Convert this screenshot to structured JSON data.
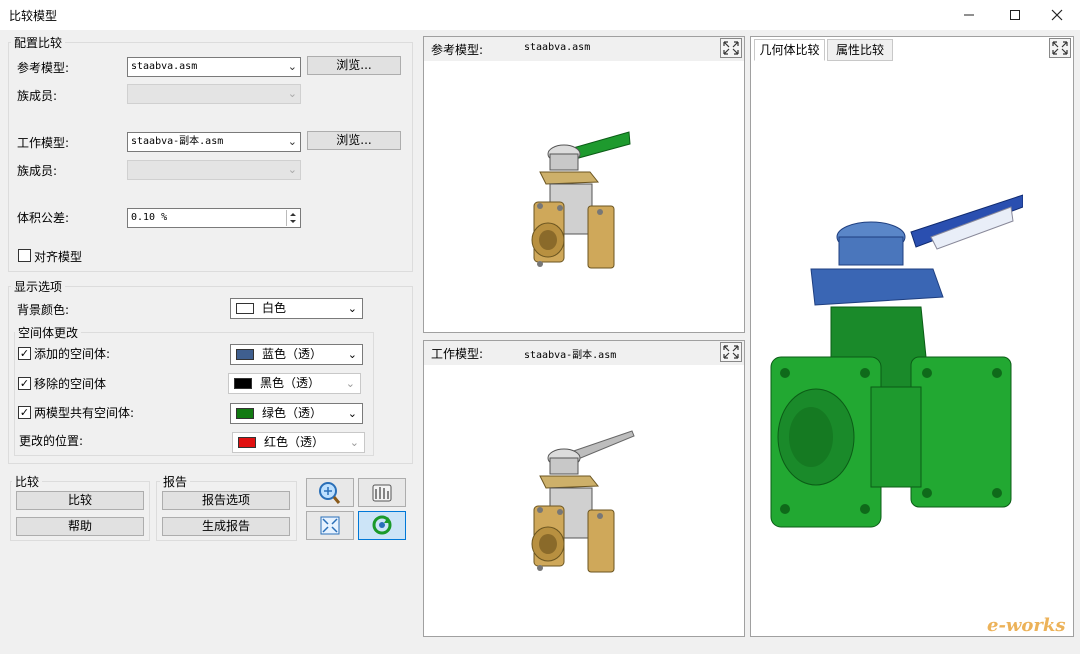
{
  "window": {
    "title": "比较模型"
  },
  "config": {
    "group_label": "配置比较",
    "ref_model_label": "参考模型:",
    "ref_model_value": "staabva.asm",
    "browse_label": "浏览...",
    "family_label": "族成员:",
    "work_model_label": "工作模型:",
    "work_model_value": "staabva-副本.asm",
    "volume_tolerance_label": "体积公差:",
    "volume_tolerance_value": "0.10 %",
    "align_models_label": "对齐模型"
  },
  "display": {
    "group_label": "显示选项",
    "bg_color_label": "背景颜色:",
    "bg_color_value": "白色",
    "space_changes_label": "空间体更改",
    "added_label": "添加的空间体:",
    "added_value": "蓝色（透）",
    "removed_label": "移除的空间体",
    "removed_value": "黑色（透）",
    "common_label": "两模型共有空间体:",
    "common_value": "绿色（透）",
    "changed_pos_label": "更改的位置:",
    "changed_pos_value": "红色（透）",
    "colors": {
      "added": "#3f5f8f",
      "removed": "#000000",
      "common": "#127a12",
      "changed": "#e01010",
      "bg": "#ffffff"
    }
  },
  "compare": {
    "group_label": "比较",
    "compare_btn": "比较",
    "help_btn": "帮助"
  },
  "report": {
    "group_label": "报告",
    "options_btn": "报告选项",
    "generate_btn": "生成报告"
  },
  "ref_pane": {
    "label": "参考模型:",
    "file": "staabva.asm"
  },
  "work_pane": {
    "label": "工作模型:",
    "file": "staabva-副本.asm"
  },
  "result_pane": {
    "tabs": [
      "几何体比较",
      "属性比较"
    ]
  },
  "watermark": "e-works"
}
